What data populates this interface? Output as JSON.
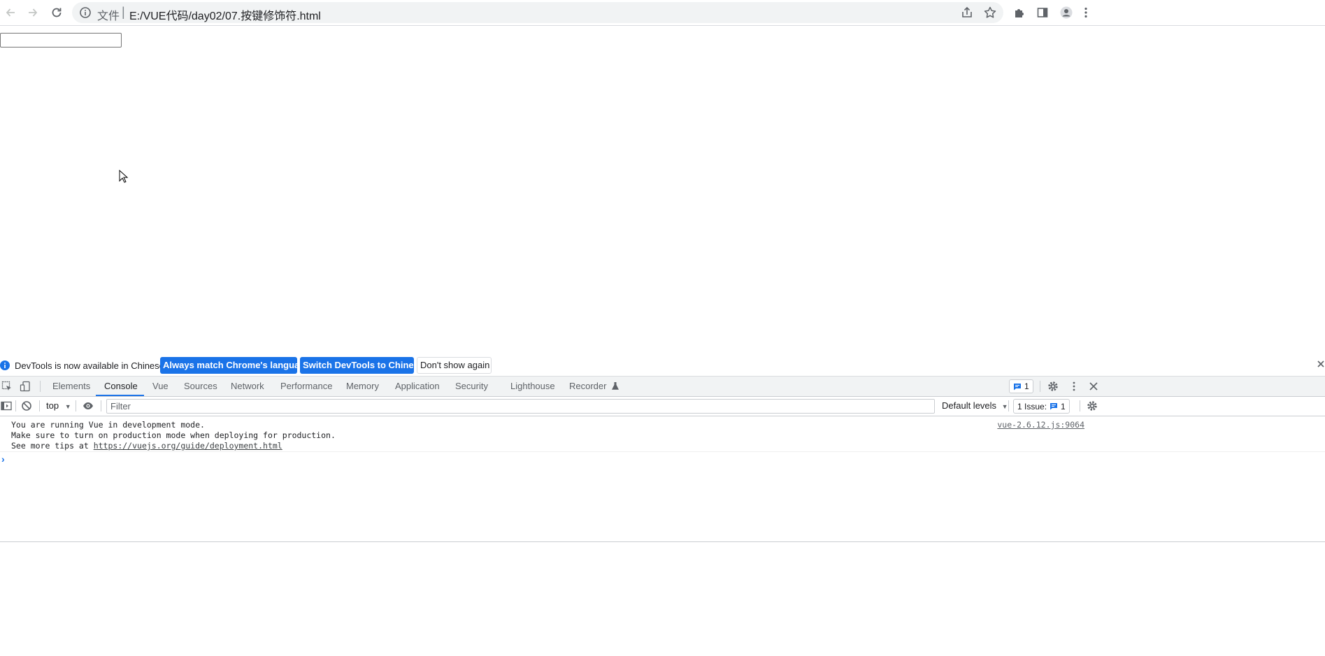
{
  "browser": {
    "url_label": "文件",
    "url_separator": "|",
    "url": "E:/VUE代码/day02/07.按键修饰符.html"
  },
  "page": {
    "input_value": ""
  },
  "infobar": {
    "message": "DevTools is now available in Chinese!",
    "btn_match": "Always match Chrome's language",
    "btn_switch": "Switch DevTools to Chinese",
    "btn_dismiss": "Don't show again"
  },
  "devtools": {
    "tabs": [
      "Elements",
      "Console",
      "Vue",
      "Sources",
      "Network",
      "Performance",
      "Memory",
      "Application",
      "Security",
      "Lighthouse",
      "Recorder"
    ],
    "active_tab": "Console",
    "issues_count": "1"
  },
  "console_toolbar": {
    "context": "top",
    "filter_placeholder": "Filter",
    "levels": "Default levels",
    "issues_label": "1 Issue:",
    "issues_count": "1"
  },
  "console": {
    "line1": "You are running Vue in development mode.",
    "line2": "Make sure to turn on production mode when deploying for production.",
    "line3_prefix": "See more tips at ",
    "line3_link": "https://vuejs.org/guide/deployment.html",
    "source": "vue-2.6.12.js:9064",
    "prompt": "›"
  },
  "colors": {
    "accent": "#1a73e8",
    "toolbar_bg": "#f1f3f4"
  }
}
